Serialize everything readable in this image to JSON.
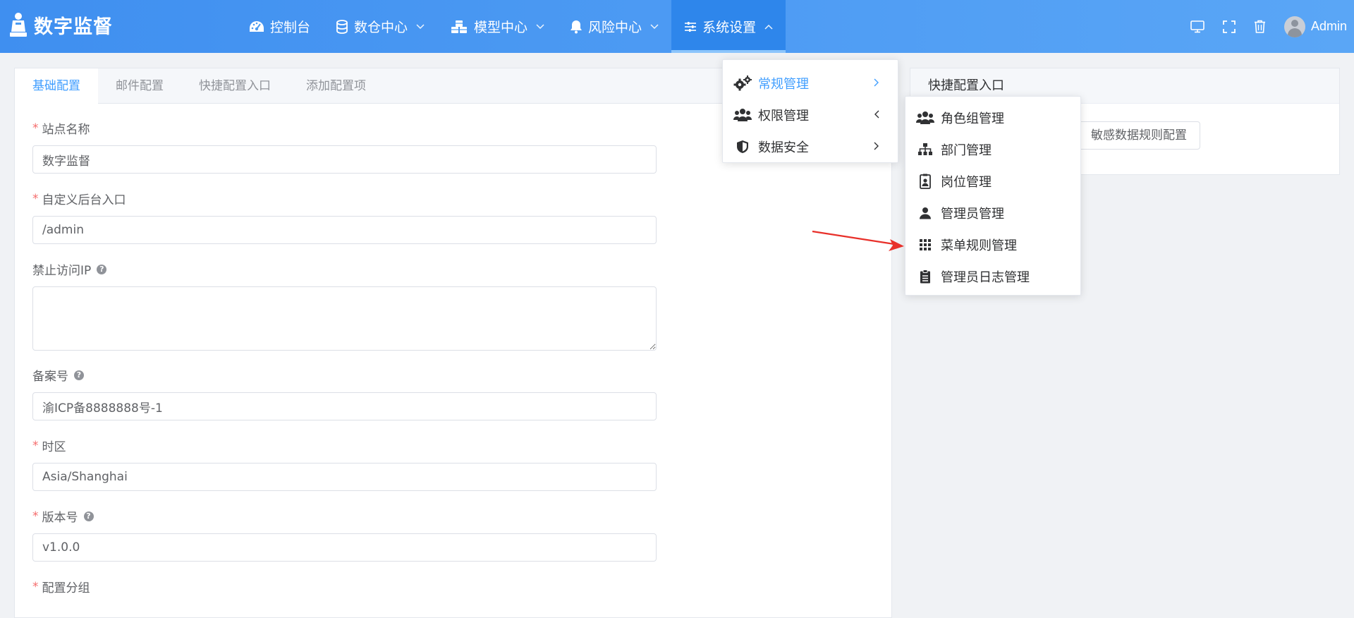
{
  "header": {
    "app_title": "数字监督",
    "nav": [
      {
        "label": "控制台",
        "icon": "dashboard-icon"
      },
      {
        "label": "数仓中心",
        "icon": "database-icon"
      },
      {
        "label": "模型中心",
        "icon": "cubes-icon"
      },
      {
        "label": "风险中心",
        "icon": "bell-icon"
      },
      {
        "label": "系统设置",
        "icon": "sliders-icon",
        "active": true
      }
    ],
    "user_name": "Admin"
  },
  "tabs": [
    "基础配置",
    "邮件配置",
    "快捷配置入口",
    "添加配置项"
  ],
  "form": {
    "site_name": {
      "label": "站点名称",
      "value": "数字监督"
    },
    "admin_entry": {
      "label": "自定义后台入口",
      "value": "/admin"
    },
    "ban_ip": {
      "label": "禁止访问IP",
      "value": ""
    },
    "record_no": {
      "label": "备案号",
      "value": "渝ICP备8888888号-1"
    },
    "timezone": {
      "label": "时区",
      "value": "Asia/Shanghai"
    },
    "version": {
      "label": "版本号",
      "value": "v1.0.0"
    },
    "config_group": {
      "label": "配置分组"
    }
  },
  "quick_config": {
    "title": "快捷配置入口",
    "button": "敏感数据规则配置"
  },
  "system_menu": [
    {
      "label": "常规管理",
      "icon": "gears-icon",
      "active": true
    },
    {
      "label": "权限管理",
      "icon": "users-icon"
    },
    {
      "label": "数据安全",
      "icon": "shield-icon"
    }
  ],
  "permission_submenu": [
    {
      "label": "角色组管理",
      "icon": "users-icon"
    },
    {
      "label": "部门管理",
      "icon": "sitemap-icon"
    },
    {
      "label": "岗位管理",
      "icon": "id-badge-icon"
    },
    {
      "label": "管理员管理",
      "icon": "user-icon"
    },
    {
      "label": "菜单规则管理",
      "icon": "grid-icon"
    },
    {
      "label": "管理员日志管理",
      "icon": "clipboard-icon"
    }
  ],
  "colors": {
    "header_start": "#3f8ff0",
    "header_end": "#5aa6f6",
    "accent": "#409eff",
    "required": "#f56c6c",
    "annotation_arrow": "#e8302a"
  }
}
